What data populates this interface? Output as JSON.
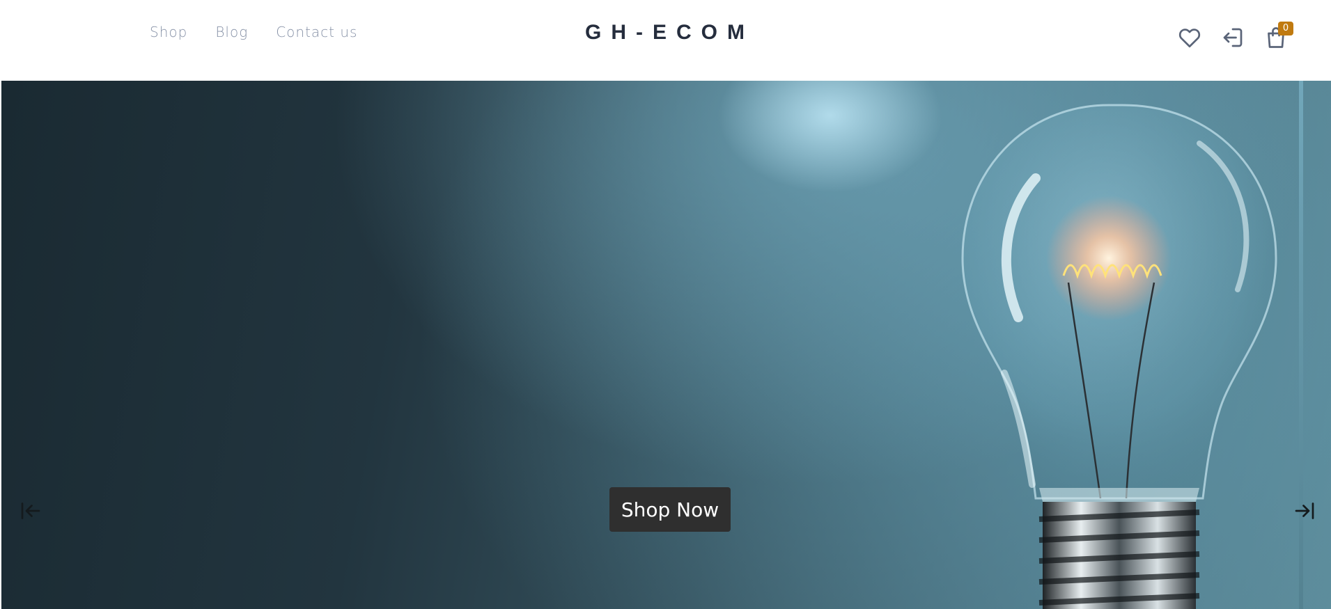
{
  "nav": {
    "items": [
      {
        "label": "Shop"
      },
      {
        "label": "Blog"
      },
      {
        "label": "Contact us"
      }
    ]
  },
  "brand": {
    "name": "GH-ECOM"
  },
  "header_icons": {
    "wishlist": "heart-icon",
    "login": "sign-in-icon",
    "cart": "shopping-bag-icon",
    "cart_count": "0"
  },
  "hero": {
    "cta_label": "Shop Now",
    "prev_icon": "arrow-left-to-line-icon",
    "next_icon": "arrow-right-to-line-icon",
    "image": "light-bulb"
  },
  "colors": {
    "brand_text": "#252d3d",
    "nav_text": "#8792a7",
    "badge": "#c07a10",
    "cta_bg": "#2f2f2f"
  }
}
